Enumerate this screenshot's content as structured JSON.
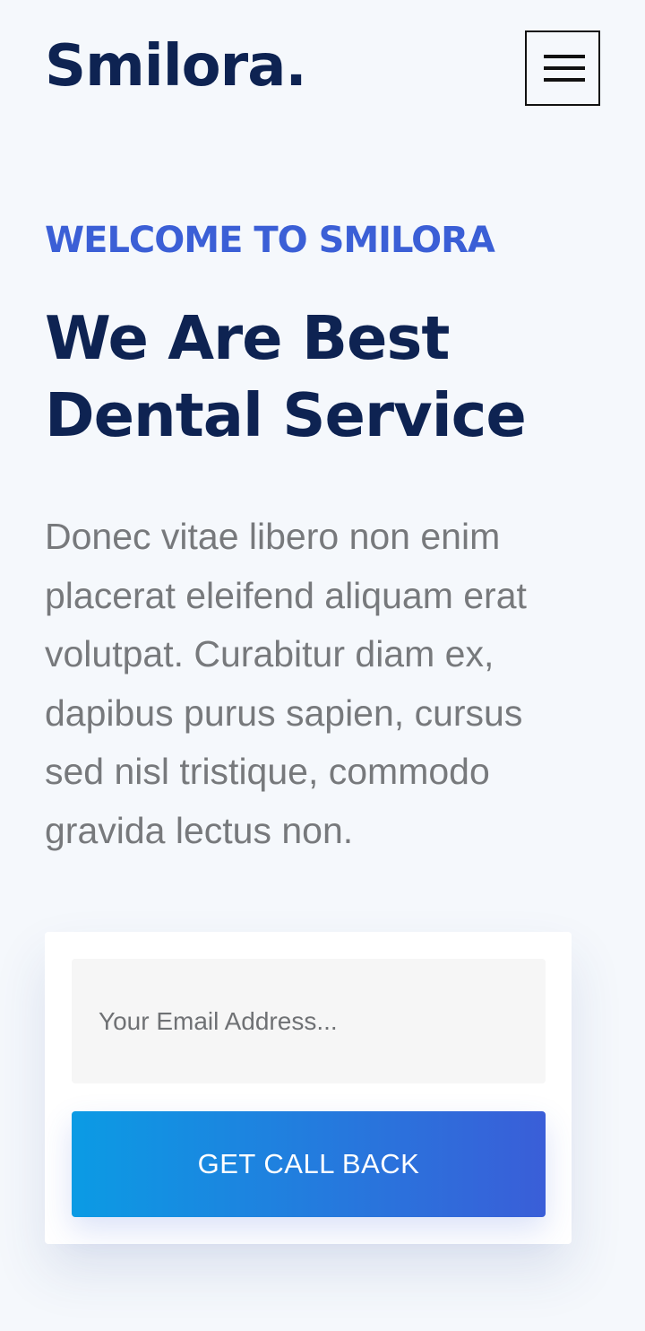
{
  "header": {
    "logo_text": "Smilora.",
    "menu_icon": "hamburger-menu-icon"
  },
  "hero": {
    "eyebrow": "WELCOME TO SMILORA",
    "title": "We Are Best Dental Service",
    "description": "Donec vitae libero non enim placerat eleifend aliquam erat volutpat. Curabitur diam ex, dapibus purus sapien, cursus sed nisl tristique, commodo gravida lectus non."
  },
  "callback_form": {
    "email_value": "",
    "email_placeholder": "Your Email Address...",
    "button_label": "GET CALL BACK"
  },
  "colors": {
    "page_background": "#f5f8fc",
    "heading": "#0e2352",
    "accent": "#3b5fd6",
    "body_text": "#77797c",
    "button_gradient_start": "#0b9be4",
    "button_gradient_end": "#3a5ed8"
  }
}
